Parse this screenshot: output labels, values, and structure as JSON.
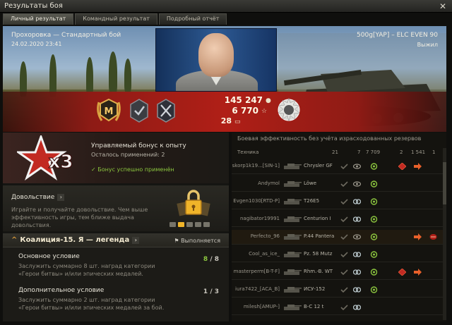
{
  "window": {
    "title": "Результаты боя",
    "close_glyph": "✕"
  },
  "tabs": [
    {
      "label": "Личный результат"
    },
    {
      "label": "Командный результат"
    },
    {
      "label": "Подробный отчёт"
    }
  ],
  "banner": {
    "battle_title": "Прохоровка — Стандартный бой",
    "date": "24.02.2020 23:41",
    "vehicle_title": "500g[YAP] – ELC EVEN 90",
    "status": "Выжил"
  },
  "rewards": {
    "credits": "145 247",
    "experience": "6 770",
    "free_xp": "28",
    "mastery_letter": "M",
    "credits_icon": "coin-icon",
    "xp_icon": "star-icon",
    "free_xp_icon": "free-xp-icon"
  },
  "bonus": {
    "multiplier": "x3",
    "title": "Управляемый бонус к опыту",
    "uses_left": "Осталось применений: 2",
    "applied": "✓ Бонус успешно применён"
  },
  "satisfaction": {
    "title": "Довольствие",
    "arrow": "›",
    "description": "Играйте и получайте довольствие. Чем выше эффективность игры, тем ближе выдача довольствия."
  },
  "mission": {
    "title": "Коалиция-15. Я — легенда",
    "arrow": "›",
    "status": "⚑ Выполняется",
    "conditions": [
      {
        "title": "Основное условие",
        "description": "Заслужить суммарно 8 шт. наград категории «Герои битвы» и/или эпических медалей.",
        "done": "8",
        "total": "/ 8"
      },
      {
        "title": "Дополнительное условие",
        "description": "Заслужить суммарно 2 шт. наград категории «Герои битвы» и/или эпических медалей за бой.",
        "done": "1",
        "total": "/ 3"
      }
    ]
  },
  "efficiency": {
    "title": "Боевая эффективность без учёта израсходованных резервов",
    "headers": {
      "vehicle": "Техника",
      "c1": "21",
      "c2": "7",
      "c3": "7 709",
      "c4": "2",
      "c5": "1 541",
      "c6": "1"
    },
    "rows": [
      {
        "player": "skorp1k19...[SIN-1]",
        "tank": "Chrysler GF",
        "icons": [
          "tick-icon",
          "eye-icon",
          "damage-icon",
          "crit-icon",
          "fire-arrow-icon"
        ]
      },
      {
        "player": "Andymol",
        "tank": "Löwe",
        "icons": [
          "tick-icon",
          "eye-icon",
          "damage-icon"
        ]
      },
      {
        "player": "Evgen1030[RTD-P]",
        "tank": "T26E5",
        "icons": [
          "tick-icon",
          "spot-icon",
          "damage-icon"
        ]
      },
      {
        "player": "nagibator19991",
        "tank": "Centurion I",
        "icons": [
          "tick-icon",
          "spot-icon",
          "damage-icon"
        ]
      },
      {
        "player": "Perfecto_96",
        "tank": "P.44 Pantera",
        "icons": [
          "tick-icon",
          "eye-icon",
          "damage-icon",
          "fire-arrow-icon",
          "kill-icon"
        ]
      },
      {
        "player": "Cool_as_ice_",
        "tank": "Pz. 58 Mutz",
        "icons": [
          "tick-icon",
          "spot-icon",
          "damage-icon"
        ]
      },
      {
        "player": "masterperm[B-T-F]",
        "tank": "Rhm.-B. WT",
        "icons": [
          "tick-icon",
          "spot-icon",
          "damage-icon",
          "crit-icon",
          "fire-arrow-icon"
        ]
      },
      {
        "player": "iura7422_[ACA_B]",
        "tank": "ИСУ-152",
        "icons": [
          "tick-icon",
          "spot-icon",
          "damage-icon"
        ]
      },
      {
        "player": "milesh[AMUP-]",
        "tank": "B-C 12 t",
        "icons": [
          "tick-icon",
          "spot-icon"
        ]
      }
    ]
  },
  "colors": {
    "accent_red": "#b01f17",
    "success_green": "#8cc63f",
    "gold": "#f0b429"
  }
}
